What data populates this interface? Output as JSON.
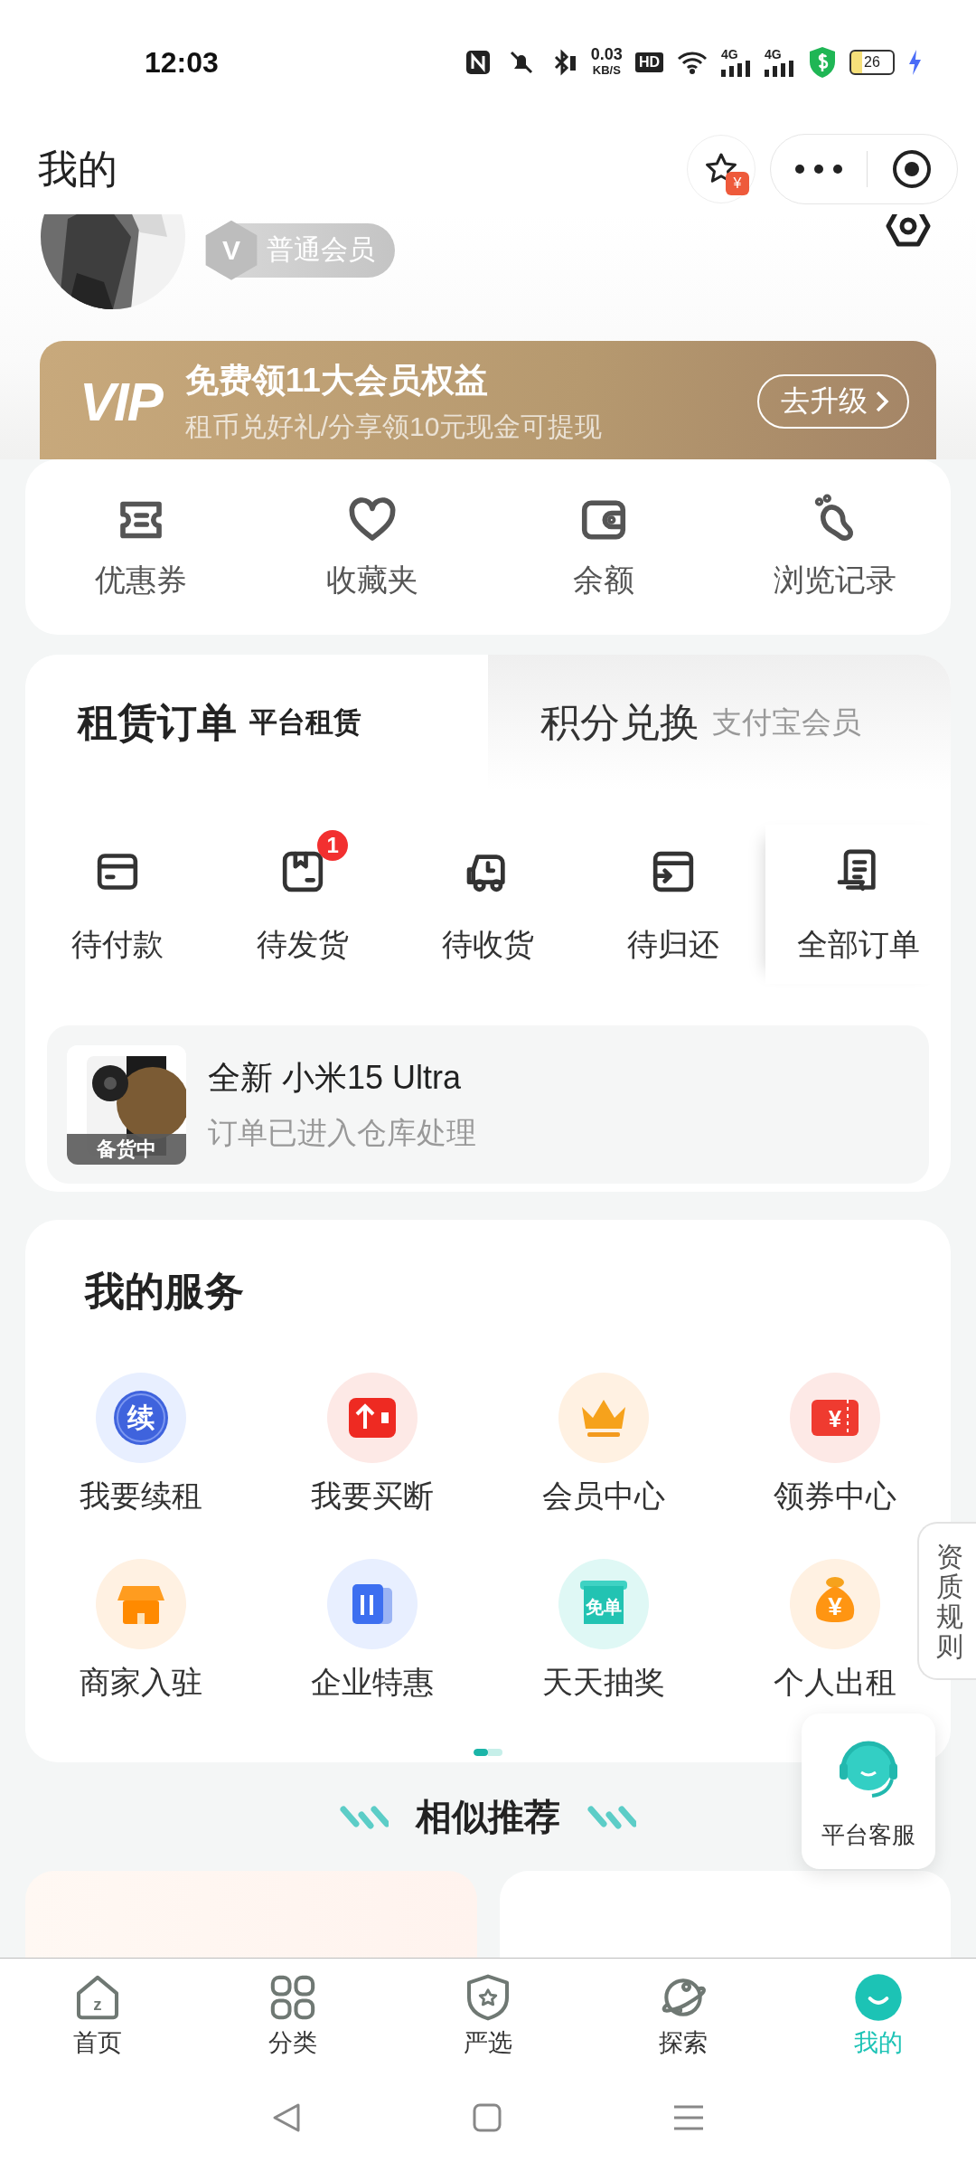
{
  "status_bar": {
    "time": "12:03",
    "net_speed": "0.03",
    "net_unit": "KB/S",
    "hd": "HD",
    "signals": [
      "4G",
      "4G"
    ],
    "battery": "26"
  },
  "header": {
    "title": "我的",
    "fav_badge": "¥"
  },
  "profile": {
    "member_badge": "V",
    "member_level": "普通会员"
  },
  "vip_banner": {
    "logo": "VIP",
    "title": "免费领11大会员权益",
    "subtitle": "租币兑好礼/分享领10元现金可提现",
    "button": "去升级"
  },
  "quick_links": [
    {
      "kind": "coupon",
      "label": "优惠券"
    },
    {
      "kind": "favorites",
      "label": "收藏夹"
    },
    {
      "kind": "balance",
      "label": "余额"
    },
    {
      "kind": "history",
      "label": "浏览记录"
    }
  ],
  "order_tabs": [
    {
      "title": "租赁订单",
      "subtitle": "平台租赁",
      "selected": true
    },
    {
      "title": "积分兑换",
      "subtitle": "支付宝会员",
      "selected": false
    }
  ],
  "order_statuses": [
    {
      "kind": "pay",
      "label": "待付款"
    },
    {
      "kind": "ship",
      "label": "待发货",
      "badge": "1"
    },
    {
      "kind": "receive",
      "label": "待收货"
    },
    {
      "kind": "return",
      "label": "待归还"
    },
    {
      "kind": "all",
      "label": "全部订单"
    }
  ],
  "latest_order": {
    "tag": "备货中",
    "product": "全新 小米15 Ultra",
    "status": "订单已进入仓库处理"
  },
  "services": {
    "title": "我的服务",
    "items": [
      {
        "kind": "renew",
        "label": "我要续租",
        "icon_text": "续"
      },
      {
        "kind": "buyout",
        "label": "我要买断"
      },
      {
        "kind": "member",
        "label": "会员中心"
      },
      {
        "kind": "coupon",
        "label": "领券中心",
        "icon_text": "¥"
      },
      {
        "kind": "merchant",
        "label": "商家入驻"
      },
      {
        "kind": "enterprise",
        "label": "企业特惠"
      },
      {
        "kind": "lottery",
        "label": "天天抽奖",
        "icon_text": "免单"
      },
      {
        "kind": "rent_out",
        "label": "个人出租",
        "icon_text": "¥"
      }
    ],
    "pages": [
      {
        "selected": true
      },
      {
        "selected": false
      }
    ]
  },
  "recommend": {
    "title": "相似推荐"
  },
  "floating": {
    "rules_tab": "资质规则",
    "support": "平台客服"
  },
  "bottom_nav": [
    {
      "kind": "home",
      "label": "首页",
      "icon_text": "z",
      "selected": false
    },
    {
      "kind": "category",
      "label": "分类",
      "selected": false
    },
    {
      "kind": "select",
      "label": "严选",
      "selected": false
    },
    {
      "kind": "explore",
      "label": "探索",
      "selected": false
    },
    {
      "kind": "me",
      "label": "我的",
      "selected": true
    }
  ]
}
